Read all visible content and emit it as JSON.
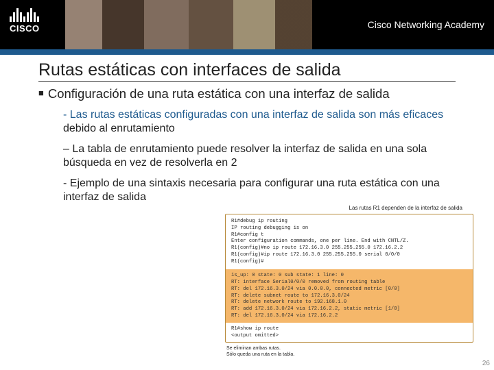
{
  "brand": {
    "logo_text": "CISCO",
    "academy": "Cisco Networking Academy"
  },
  "title": "Rutas estáticas con interfaces de salida",
  "subtitle": "Configuración de una ruta estática con una interfaz de salida",
  "paras": {
    "p1a": "- Las rutas estáticas configuradas con una interfaz de salida son ",
    "p1b": "más eficaces",
    "p1c": " debido al enrutamiento",
    "p2": "– La tabla de enrutamiento puede resolver la interfaz de salida en una sola búsqueda en vez de resolverla en 2",
    "p3": "- Ejemplo de una sintaxis necesaria para configurar una ruta estática con una interfaz de salida"
  },
  "terminal": {
    "caption": "Las rutas R1 dependen de la interfaz de salida",
    "top": "R1#debug ip routing\nIP routing debugging is on\nR1#config t\nEnter configuration commands, one per line. End with CNTL/Z.\nR1(config)#no ip route 172.16.3.0 255.255.255.0 172.16.2.2\nR1(config)#ip route 172.16.3.0 255.255.255.0 serial 0/0/0\nR1(config)#",
    "mid": "is_up: 0 state: 0 sub state: 1 line: 0\nRT: interface Serial0/0/0 removed from routing table\nRT: del 172.16.3.0/24 via 0.0.0.0, connected metric [0/0]\nRT: delete subnet route to 172.16.3.0/24\nRT: delete network route to 192.168.1.0\nRT: add 172.16.3.0/24 via 172.16.2.2, static metric [1/0]\nRT: del 172.16.3.0/24 via 172.16.2.2",
    "bot": "R1#show ip route\n<output omitted>",
    "footer1": "Se eliminan ambas rutas.",
    "footer2": "Sólo queda una ruta en la tabla."
  },
  "page_number": "26"
}
